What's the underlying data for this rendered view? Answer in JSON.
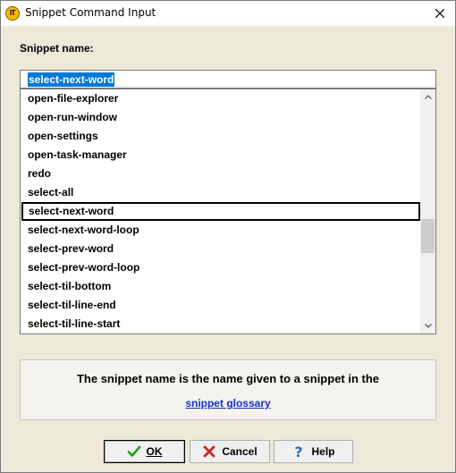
{
  "window": {
    "title": "Snippet Command Input",
    "app_icon_text": "IT"
  },
  "form": {
    "name_label": "Snippet name:",
    "name_value": "select-next-word"
  },
  "list": {
    "items": [
      "open-file-explorer",
      "open-run-window",
      "open-settings",
      "open-task-manager",
      "redo",
      "select-all",
      "select-next-word",
      "select-next-word-loop",
      "select-prev-word",
      "select-prev-word-loop",
      "select-til-bottom",
      "select-til-line-end",
      "select-til-line-start"
    ],
    "selected_index": 6
  },
  "info": {
    "text": "The snippet name is the name given to a snippet in the",
    "link_text": "snippet glossary"
  },
  "buttons": {
    "ok_label": "OK",
    "cancel_label": "Cancel",
    "help_label": "Help"
  },
  "colors": {
    "selection": "#0078d7",
    "link": "#1a2ec8",
    "ok_check": "#1fa31f",
    "cancel_x": "#c0282b",
    "help_q": "#1f6fc0"
  }
}
